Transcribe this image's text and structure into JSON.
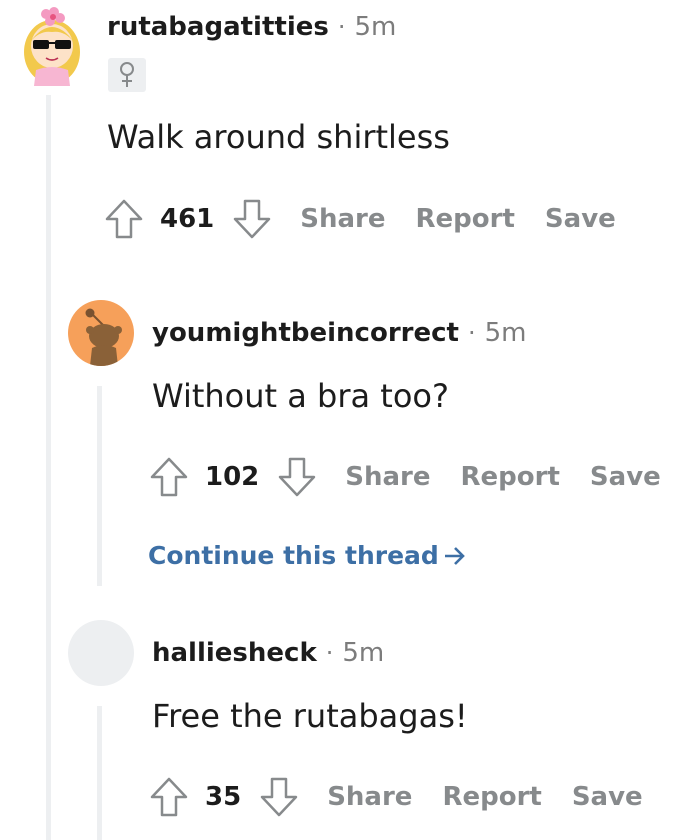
{
  "comments": [
    {
      "username": "rutabagatitties",
      "separator": "·",
      "time": "5m",
      "flair_icon": "female-symbol-icon",
      "body": "Walk around shirtless",
      "score": "461",
      "actions": [
        "Share",
        "Report",
        "Save"
      ]
    },
    {
      "username": "youmightbeincorrect",
      "separator": "·",
      "time": "5m",
      "body": "Without a bra too?",
      "score": "102",
      "actions": [
        "Share",
        "Report",
        "Save"
      ],
      "continue_label": "Continue this thread"
    },
    {
      "username": "halliesheck",
      "separator": "·",
      "time": "5m",
      "body": "Free the rutabagas!",
      "score": "35",
      "actions": [
        "Share",
        "Report",
        "Save"
      ]
    }
  ],
  "colors": {
    "thread_line": "#edeff1",
    "muted_text": "#878a8c",
    "link_blue": "#3d6fa5",
    "snoo_orange": "#f6a05a"
  }
}
